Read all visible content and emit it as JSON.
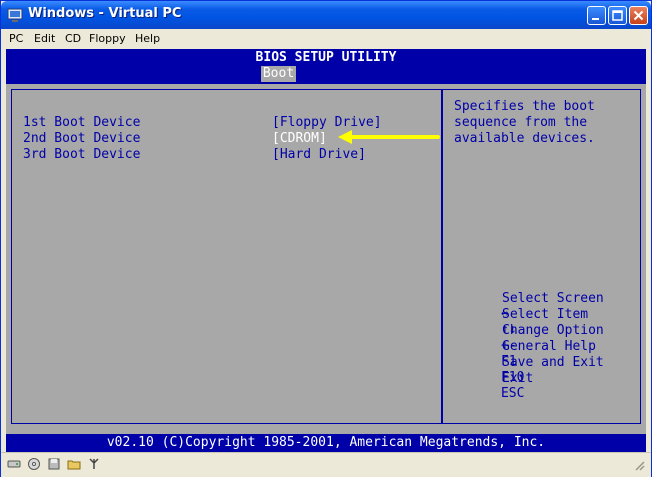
{
  "window": {
    "title": "Windows - Virtual PC"
  },
  "menubar": {
    "items": [
      "PC",
      "Edit",
      "CD",
      "Floppy",
      "Help"
    ]
  },
  "bios": {
    "title": "BIOS SETUP UTILITY",
    "active_tab": "Boot",
    "boot_devices": [
      {
        "label": "1st Boot Device",
        "value": "[Floppy Drive]"
      },
      {
        "label": "2nd Boot Device",
        "value": "[CDROM]"
      },
      {
        "label": "3rd Boot Device",
        "value": "[Hard Drive]"
      }
    ],
    "help_text": [
      "Specifies the boot",
      "sequence from the",
      "available devices."
    ],
    "keys": [
      {
        "key": "↔",
        "action": "Select Screen"
      },
      {
        "key": "↑↓",
        "action": "Select Item"
      },
      {
        "key": "+-",
        "action": "Change Option"
      },
      {
        "key": "F1",
        "action": "General Help"
      },
      {
        "key": "F10",
        "action": "Save and Exit"
      },
      {
        "key": "ESC",
        "action": "Exit"
      }
    ],
    "footer": "v02.10 (C)Copyright 1985-2001, American Megatrends, Inc."
  },
  "colors": {
    "bios_blue": "#0000A8",
    "bios_gray": "#A8A8A8",
    "annotation_arrow": "#FFFF00",
    "xp_title_blue": "#0054E3"
  },
  "statusbar": {
    "icons": [
      "hard-disk-icon",
      "cd-icon",
      "floppy-icon",
      "shared-folder-icon",
      "network-icon"
    ]
  }
}
